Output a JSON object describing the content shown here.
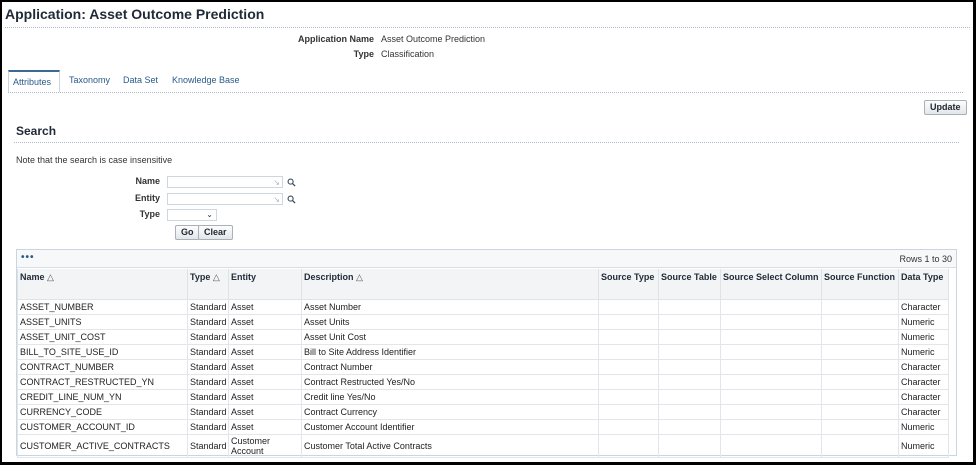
{
  "page": {
    "title": "Application: Asset Outcome Prediction"
  },
  "app_info": {
    "name_label": "Application Name",
    "name_value": "Asset Outcome Prediction",
    "type_label": "Type",
    "type_value": "Classification"
  },
  "tabs": [
    {
      "label": "Attributes",
      "active": true
    },
    {
      "label": "Taxonomy",
      "active": false
    },
    {
      "label": "Data Set",
      "active": false
    },
    {
      "label": "Knowledge Base",
      "active": false
    }
  ],
  "actions": {
    "update_label": "Update"
  },
  "search": {
    "title": "Search",
    "note": "Note that the search is case insensitive",
    "name_label": "Name",
    "entity_label": "Entity",
    "type_label": "Type",
    "go_label": "Go",
    "clear_label": "Clear"
  },
  "results": {
    "more_label": "•••",
    "rows_info": "Rows 1 to 30",
    "columns": {
      "name": "Name",
      "type": "Type",
      "entity": "Entity",
      "description": "Description",
      "source_type": "Source Type",
      "source_table": "Source Table",
      "source_select_column": "Source Select Column",
      "source_function": "Source Function",
      "data_type": "Data Type"
    },
    "sort_glyph": "△",
    "rows": [
      {
        "name": "ASSET_NUMBER",
        "type": "Standard",
        "entity": "Asset",
        "description": "Asset Number",
        "data_type": "Character"
      },
      {
        "name": "ASSET_UNITS",
        "type": "Standard",
        "entity": "Asset",
        "description": "Asset Units",
        "data_type": "Numeric"
      },
      {
        "name": "ASSET_UNIT_COST",
        "type": "Standard",
        "entity": "Asset",
        "description": "Asset Unit Cost",
        "data_type": "Numeric"
      },
      {
        "name": "BILL_TO_SITE_USE_ID",
        "type": "Standard",
        "entity": "Asset",
        "description": "Bill to Site Address Identifier",
        "data_type": "Numeric"
      },
      {
        "name": "CONTRACT_NUMBER",
        "type": "Standard",
        "entity": "Asset",
        "description": "Contract Number",
        "data_type": "Character"
      },
      {
        "name": "CONTRACT_RESTRUCTED_YN",
        "type": "Standard",
        "entity": "Asset",
        "description": "Contract Restructed Yes/No",
        "data_type": "Character"
      },
      {
        "name": "CREDIT_LINE_NUM_YN",
        "type": "Standard",
        "entity": "Asset",
        "description": "Credit line Yes/No",
        "data_type": "Character"
      },
      {
        "name": "CURRENCY_CODE",
        "type": "Standard",
        "entity": "Asset",
        "description": "Contract Currency",
        "data_type": "Character"
      },
      {
        "name": "CUSTOMER_ACCOUNT_ID",
        "type": "Standard",
        "entity": "Asset",
        "description": "Customer Account Identifier",
        "data_type": "Numeric"
      },
      {
        "name": "CUSTOMER_ACTIVE_CONTRACTS",
        "type": "Standard",
        "entity": "Customer Account",
        "description": "Customer Total Active Contracts",
        "data_type": "Numeric"
      }
    ]
  }
}
